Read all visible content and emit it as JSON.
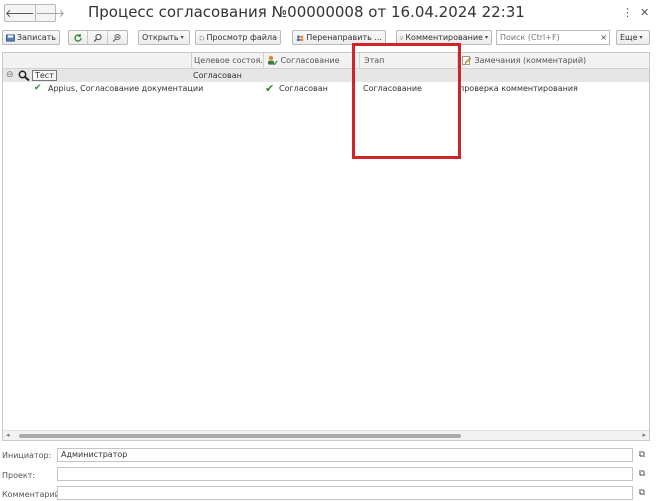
{
  "window": {
    "title": "Процесс согласования №00000008 от 16.04.2024 22:31",
    "back_glyph": "🡐",
    "forward_glyph": "🡒",
    "more_glyph": "⋮",
    "close_glyph": "✕"
  },
  "toolbar": {
    "save_label": "Записать",
    "open_label": "Открыть",
    "view_file_label": "Просмотр файла",
    "redirect_label": "Перенаправить ...",
    "comment_label": "Комментирование",
    "search_placeholder": "Поиск (Ctrl+F)",
    "search_clear": "×",
    "more_label": "Еще",
    "caret": "▾"
  },
  "table": {
    "columns": [
      "",
      "Целевое состоя...",
      "Согласование",
      "Этап",
      "Замечания (комментарий)"
    ],
    "group_row": {
      "expander": "⊖",
      "name": "Тест",
      "target_state": "Согласован"
    },
    "rows": [
      {
        "check": "✔",
        "participant": "Appius, Согласование документации",
        "approval_check": "✔",
        "approval": "Согласован",
        "stage": "Согласование",
        "remarks": "проверка комментирования"
      }
    ]
  },
  "form": {
    "initiator_label": "Инициатор:",
    "initiator_value": "Администратор",
    "project_label": "Проект:",
    "project_value": "",
    "comment_label": "Комментарий:",
    "comment_value": "",
    "open_glyph": "⧉"
  },
  "colors": {
    "accent_check": "#2e8b3a",
    "annotation": "#d2232a"
  }
}
